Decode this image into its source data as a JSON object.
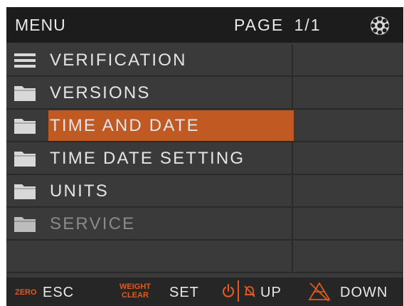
{
  "header": {
    "title": "MENU",
    "page": "PAGE 1/1",
    "settings_icon": "gear-icon"
  },
  "menu": {
    "items": [
      {
        "label": "VERIFICATION",
        "icon": "list-icon",
        "selected": false,
        "disabled": false
      },
      {
        "label": "VERSIONS",
        "icon": "folder-icon",
        "selected": false,
        "disabled": false
      },
      {
        "label": "TIME AND DATE",
        "icon": "folder-icon",
        "selected": true,
        "disabled": false
      },
      {
        "label": "TIME DATE SETTING",
        "icon": "folder-icon",
        "selected": false,
        "disabled": false
      },
      {
        "label": "UNITS",
        "icon": "folder-icon",
        "selected": false,
        "disabled": false
      },
      {
        "label": "SERVICE",
        "icon": "folder-icon",
        "selected": false,
        "disabled": true
      },
      {
        "label": "",
        "icon": "",
        "selected": false,
        "disabled": false
      }
    ]
  },
  "footer": {
    "zero_key": "ZERO",
    "esc_label": "ESC",
    "weight_key_line1": "WEIGHT",
    "weight_key_line2": "CLEAR",
    "set_label": "SET",
    "up_label": "UP",
    "down_label": "DOWN"
  },
  "colors": {
    "accent": "#c05a22",
    "key_orange": "#e05a1e",
    "background": "#3a3a3a",
    "header": "#1c1c1c"
  }
}
